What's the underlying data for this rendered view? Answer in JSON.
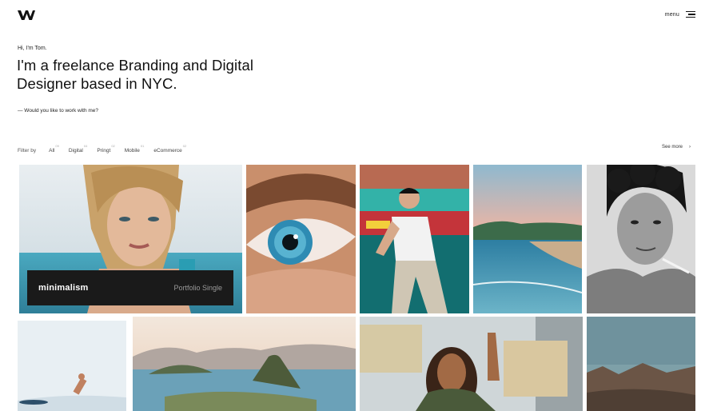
{
  "header": {
    "logo_icon": "w-logo-icon",
    "menu_label": "menu",
    "menu_icon": "hamburger-icon"
  },
  "hero": {
    "greeting": "Hi, I'm Tom.",
    "headline": "I'm a freelance Branding and Digital Designer based in NYC.",
    "cta": "— Would you like to work with me?"
  },
  "filter": {
    "label": "Filter by",
    "items": [
      {
        "label": "All",
        "count": "09"
      },
      {
        "label": "Digital",
        "count": "04"
      },
      {
        "label": "Pringt",
        "count": "02"
      },
      {
        "label": "Mobile",
        "count": "01"
      },
      {
        "label": "eCommerce",
        "count": "02"
      }
    ],
    "see_more": "See more",
    "see_more_icon": "arrow-icon"
  },
  "portfolio": {
    "featured_title": "minimalism",
    "featured_subtitle": "Portfolio Single"
  },
  "colors": {
    "text": "#111111",
    "caption_bg": "#1a1a1a",
    "muted": "#9a9a9a"
  }
}
